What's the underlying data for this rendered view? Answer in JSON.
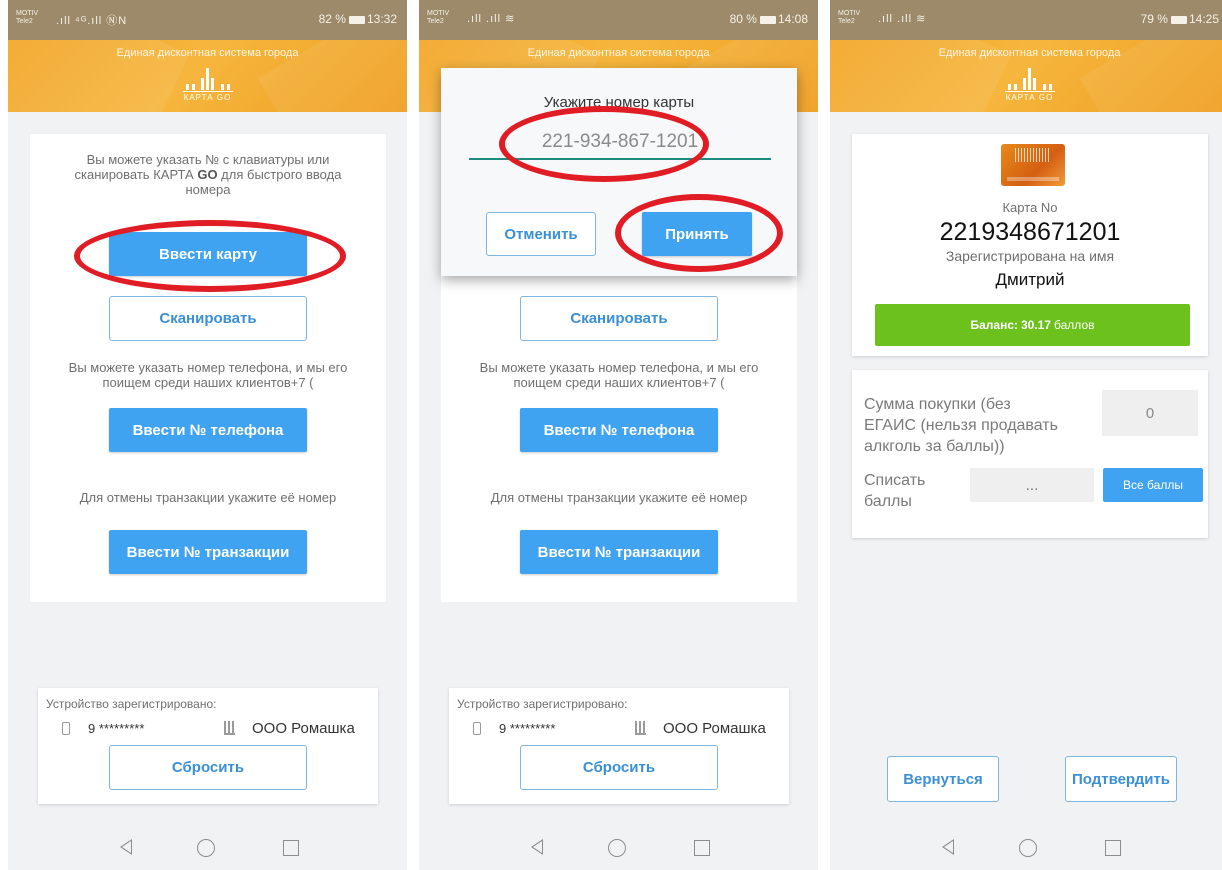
{
  "colors": {
    "status_bar": "#9c8a6a",
    "header": "#f2a526",
    "accent_blue": "#3fa3f1",
    "outline_blue": "#3a8fd6",
    "balance_green": "#6cc11c",
    "annotation_red": "#e01d24"
  },
  "common": {
    "header_subtitle": "Единая дисконтная система города",
    "logo_text": "КАРТА GO",
    "device": {
      "title": "Устройство зарегистрировано:",
      "phone": "9 *********",
      "org": "ООО Ромашка",
      "reset_label": "Сбросить"
    },
    "buttons": {
      "scan": "Сканировать",
      "enter_phone": "Ввести № телефона",
      "enter_transaction": "Ввести № транзакции"
    },
    "texts": {
      "phone_hint_1": "Вы можете указать номер телефона, и мы его",
      "phone_hint_2": "поищем среди наших клиентов+7 (",
      "cancel_hint": "Для отмены транзакции укажите её номер"
    },
    "icons": [
      "back-icon",
      "home-icon",
      "recent-apps-icon",
      "phone-icon",
      "building-icon"
    ]
  },
  "screens": [
    {
      "status": {
        "carrier_1": "MOTIV",
        "carrier_2": "Tele2",
        "signal": ".ıll ⁴ᴳ.ıll ⓃN",
        "battery": "82 %",
        "time": "13:32"
      },
      "intro_1": "Вы можете указать № с клавиатуры или",
      "intro_2_pre": "сканировать КАРТА ",
      "intro_2_bold": "GO",
      "intro_2_post": " для быстрого ввода",
      "intro_3": "номера",
      "enter_card": "Ввести карту"
    },
    {
      "status": {
        "carrier_1": "MOTIV",
        "carrier_2": "Tele2",
        "signal": ".ıll .ıll ≋",
        "battery": "80 %",
        "time": "14:08"
      },
      "dialog": {
        "title": "Укажите номер карты",
        "value": "221-934-867-1201",
        "cancel": "Отменить",
        "accept": "Принять"
      }
    },
    {
      "status": {
        "carrier_1": "MOTIV",
        "carrier_2": "Tele2",
        "signal": ".ıll .ıll ≋",
        "battery": "79 %",
        "time": "14:25"
      },
      "card_label": "Карта No",
      "card_number": "2219348671201",
      "registered_label": "Зарегистрирована на имя",
      "holder": "Дмитрий",
      "balance_prefix": "Баланс:",
      "balance_value": "30.17",
      "balance_unit": "баллов",
      "purchase_label_1": "Сумма покупки (без",
      "purchase_label_2": "ЕГАИС (нельзя продавать",
      "purchase_label_3": "алкголь за баллы))",
      "purchase_value": "0",
      "writeoff_label_1": "Списать",
      "writeoff_label_2": "баллы",
      "writeoff_placeholder": "...",
      "all_points": "Все баллы",
      "back": "Вернуться",
      "confirm": "Подтвердить"
    }
  ]
}
